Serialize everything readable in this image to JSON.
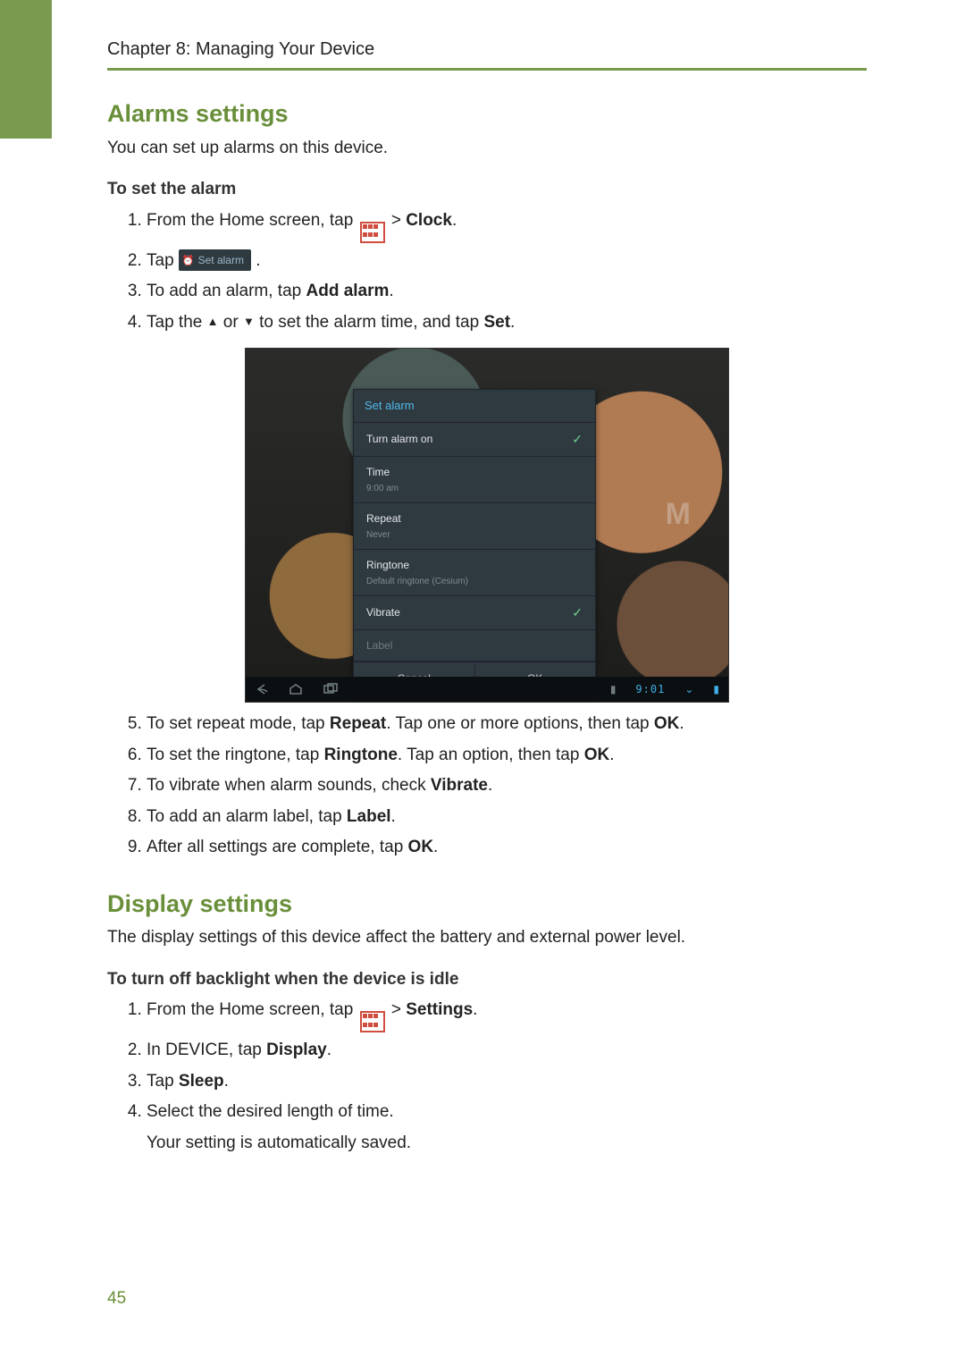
{
  "chapter_line": "Chapter 8: Managing Your Device",
  "page_number": "45",
  "alarms_h2": "Alarms settings",
  "alarms_intro": "You can set up alarms on this device.",
  "alarms_sub": "To set the alarm",
  "step_a1_pre": "From the Home screen, tap ",
  "step_a1_gt": " > ",
  "step_a1_bold": "Clock",
  "step_a1_post": ".",
  "step_a2_pre": "Tap ",
  "set_alarm_pill": "Set alarm",
  "step_a2_post": ".",
  "step_a3_pre": "To add an alarm, tap ",
  "step_a3_bold": "Add alarm",
  "step_a3_post": ".",
  "step_a4_pre": "Tap the ",
  "step_a4_up": "▲",
  "step_a4_mid": " or ",
  "step_a4_down": "▼",
  "step_a4_mid2": " to set the alarm time, and tap ",
  "step_a4_bold": "Set",
  "step_a4_post": ".",
  "step_a5_pre": "To set repeat mode, tap ",
  "step_a5_b1": "Repeat",
  "step_a5_mid": ". Tap one or more options, then tap ",
  "step_a5_b2": "OK",
  "step_a5_post": ".",
  "step_a6_pre": "To set the ringtone, tap ",
  "step_a6_b1": "Ringtone",
  "step_a6_mid": ". Tap an option, then tap ",
  "step_a6_b2": "OK",
  "step_a6_post": ".",
  "step_a7_pre": "To vibrate when alarm sounds, check ",
  "step_a7_bold": "Vibrate",
  "step_a7_post": ".",
  "step_a8_pre": "To add an alarm label, tap ",
  "step_a8_bold": "Label",
  "step_a8_post": ".",
  "step_a9_pre": "After all settings are complete, tap ",
  "step_a9_bold": "OK",
  "step_a9_post": ".",
  "display_h2": "Display settings",
  "display_intro": "The display settings of this device affect the battery and external power level.",
  "display_sub": "To turn off backlight when the device is idle",
  "step_d1_pre": "From the Home screen, tap ",
  "step_d1_gt": " > ",
  "step_d1_bold": "Settings",
  "step_d1_post": ".",
  "step_d2_pre": "In DEVICE, tap ",
  "step_d2_bold": "Display",
  "step_d2_post": ".",
  "step_d3_pre": "Tap ",
  "step_d3_bold": "Sleep",
  "step_d3_post": ".",
  "step_d4": "Select the desired length of time.",
  "step_d4_note": "Your setting is automatically saved.",
  "shot": {
    "dialog_title": "Set alarm",
    "row_turn_on": "Turn alarm on",
    "row_time": "Time",
    "row_time_sub": "9:00 am",
    "row_repeat": "Repeat",
    "row_repeat_sub": "Never",
    "row_ringtone": "Ringtone",
    "row_ringtone_sub": "Default ringtone (Cesium)",
    "row_vibrate": "Vibrate",
    "row_label": "Label",
    "btn_cancel": "Cancel",
    "btn_ok": "OK",
    "status_time": "9:01",
    "watermark": "M"
  }
}
